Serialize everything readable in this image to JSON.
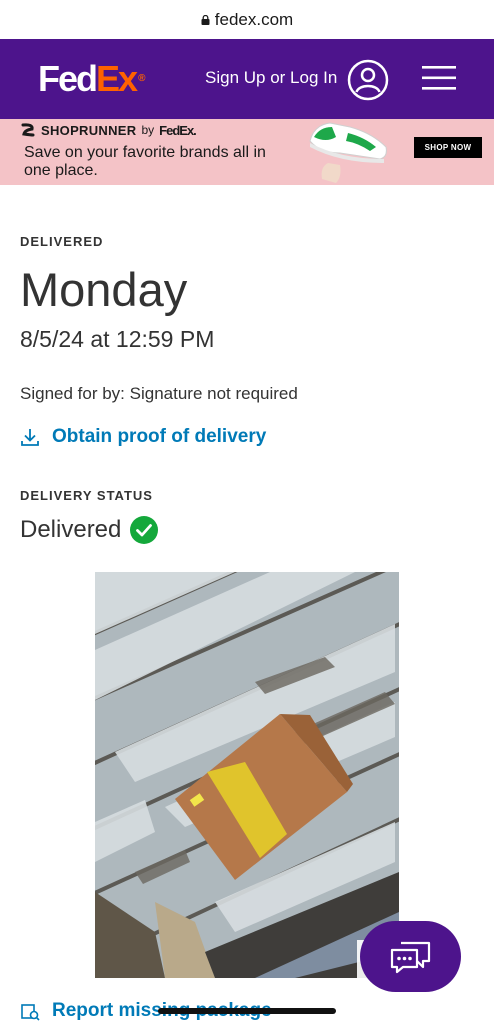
{
  "browser": {
    "url": "fedex.com"
  },
  "header": {
    "logo_fed": "Fed",
    "logo_ex": "Ex",
    "logo_mark": "®",
    "signin_label": "Sign Up or Log In",
    "icons": [
      "user-icon",
      "menu-icon"
    ],
    "background_color": "#4d148c",
    "accent_color": "#ff6200"
  },
  "banner": {
    "brand": "SHOPRUNNER",
    "by": "by",
    "partner": "FedEx.",
    "tagline": "Save on your favorite brands all in one place.",
    "cta": "SHOP NOW",
    "background_color": "#f4c3c7"
  },
  "tracking": {
    "delivered_label": "DELIVERED",
    "day": "Monday",
    "datetime": "8/5/24 at 12:59 PM",
    "signed_for": "Signed for by: Signature not required",
    "proof_link": "Obtain proof of delivery",
    "status_label": "DELIVERY STATUS",
    "status_value": "Delivered",
    "status_color": "#14a83b",
    "link_color": "#007ab7"
  },
  "footer": {
    "report_link": "Report missing package",
    "chat_icon": "chat-bubbles-icon"
  }
}
